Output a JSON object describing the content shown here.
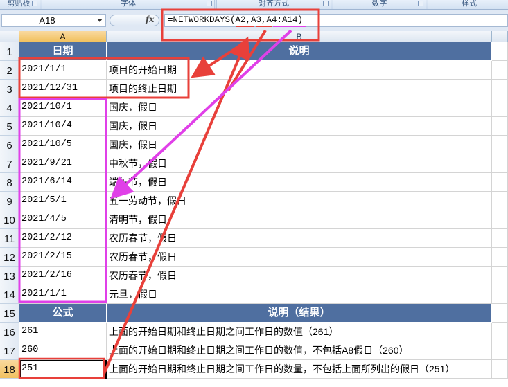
{
  "ribbon": {
    "groups": [
      "剪贴板",
      "字体",
      "对齐方式",
      "数字",
      "样式"
    ]
  },
  "formula_bar": {
    "name_box": "A18",
    "fx_label": "fx",
    "formula": "=NETWORKDAYS(A2,A3,A4:A14)"
  },
  "columns": [
    "A",
    "B"
  ],
  "rows": [
    {
      "num": "1",
      "a": "日期",
      "b": "说明",
      "header": true
    },
    {
      "num": "2",
      "a": "2021/1/1",
      "b": "项目的开始日期"
    },
    {
      "num": "3",
      "a": "2021/12/31",
      "b": "项目的终止日期"
    },
    {
      "num": "4",
      "a": "2021/10/1",
      "b": "国庆，假日"
    },
    {
      "num": "5",
      "a": "2021/10/4",
      "b": "国庆，假日"
    },
    {
      "num": "6",
      "a": "2021/10/5",
      "b": "国庆，假日"
    },
    {
      "num": "7",
      "a": "2021/9/21",
      "b": "中秋节，假日"
    },
    {
      "num": "8",
      "a": "2021/6/14",
      "b": "端午节，假日"
    },
    {
      "num": "9",
      "a": "2021/5/1",
      "b": "五一劳动节，假日"
    },
    {
      "num": "10",
      "a": "2021/4/5",
      "b": "清明节，假日"
    },
    {
      "num": "11",
      "a": "2021/2/12",
      "b": "农历春节，假日"
    },
    {
      "num": "12",
      "a": "2021/2/15",
      "b": "农历春节，假日"
    },
    {
      "num": "13",
      "a": "2021/2/16",
      "b": "农历春节，假日"
    },
    {
      "num": "14",
      "a": "2021/1/1",
      "b": "元旦，假日"
    },
    {
      "num": "15",
      "a": "公式",
      "b": "说明（结果）",
      "header": true
    },
    {
      "num": "16",
      "a": "261",
      "b": "上面的开始日期和终止日期之间工作日的数值（261）"
    },
    {
      "num": "17",
      "a": "260",
      "b": "上面的开始日期和终止日期之间工作日的数值，不包括A8假日（260）"
    },
    {
      "num": "18",
      "a": "251",
      "b": "上面的开始日期和终止日期之间工作日的数量，不包括上面所列出的假日（251）"
    }
  ],
  "colors": {
    "header_fill": "#4f6fa0",
    "annotation_red": "#e8403a",
    "annotation_magenta": "#e040e8"
  }
}
